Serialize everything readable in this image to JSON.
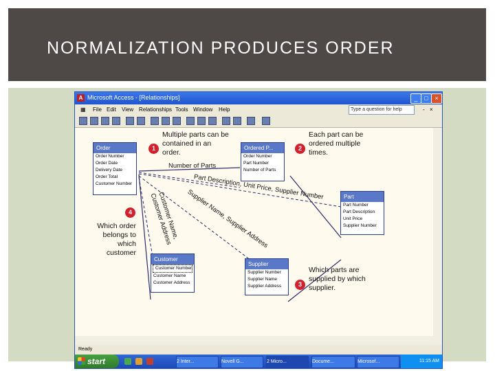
{
  "slide": {
    "title": "NORMALIZATION PRODUCES ORDER"
  },
  "window": {
    "title": "Microsoft Access - [Relationships]",
    "buttons": {
      "minimize": "_",
      "maximize": "□",
      "close": "×"
    },
    "menu": [
      "File",
      "Edit",
      "View",
      "Relationships",
      "Tools",
      "Window",
      "Help"
    ],
    "help_placeholder": "Type a question for help",
    "status": "Ready"
  },
  "tables": {
    "order": {
      "title": "Order",
      "fields": [
        "Order Number",
        "Order Date",
        "Delivery Date",
        "Order Total",
        "Customer Number"
      ]
    },
    "ordered_parts": {
      "title": "Ordered P...",
      "fields": [
        "Order Number",
        "Part Number",
        "Number of Parts"
      ]
    },
    "part": {
      "title": "Part",
      "fields": [
        "Part Number",
        "Part Description",
        "Unit Price",
        "Supplier Number"
      ]
    },
    "customer": {
      "title": "Customer",
      "fields": [
        "Customer Number",
        "Customer Name",
        "Customer Address"
      ]
    },
    "supplier": {
      "title": "Supplier",
      "fields": [
        "Supplier Number",
        "Supplier Name",
        "Supplier Address"
      ]
    }
  },
  "callouts": {
    "c1": {
      "badge": "1",
      "text": "Multiple parts can be contained in an order."
    },
    "c2": {
      "badge": "2",
      "text": "Each part can be ordered multiple times."
    },
    "c3": {
      "badge": "3",
      "text": "Which parts are supplied by which supplier."
    },
    "c4": {
      "badge": "4",
      "text": "Which order belongs to which customer"
    }
  },
  "relationship_labels": {
    "number_of_parts": "Number of Parts",
    "part_desc": "Part Description, Unit Price, Supplier Number",
    "supplier_name": "Supplier Name, Supplier Address",
    "customer_name": "Customer Name,",
    "customer_address": "Customer Address"
  },
  "taskbar": {
    "start": "start",
    "tasks": [
      "2 Inter...",
      "Novell G...",
      "2 Micro...",
      "Docume...",
      "Microsof..."
    ],
    "clock": "11:15 AM"
  }
}
